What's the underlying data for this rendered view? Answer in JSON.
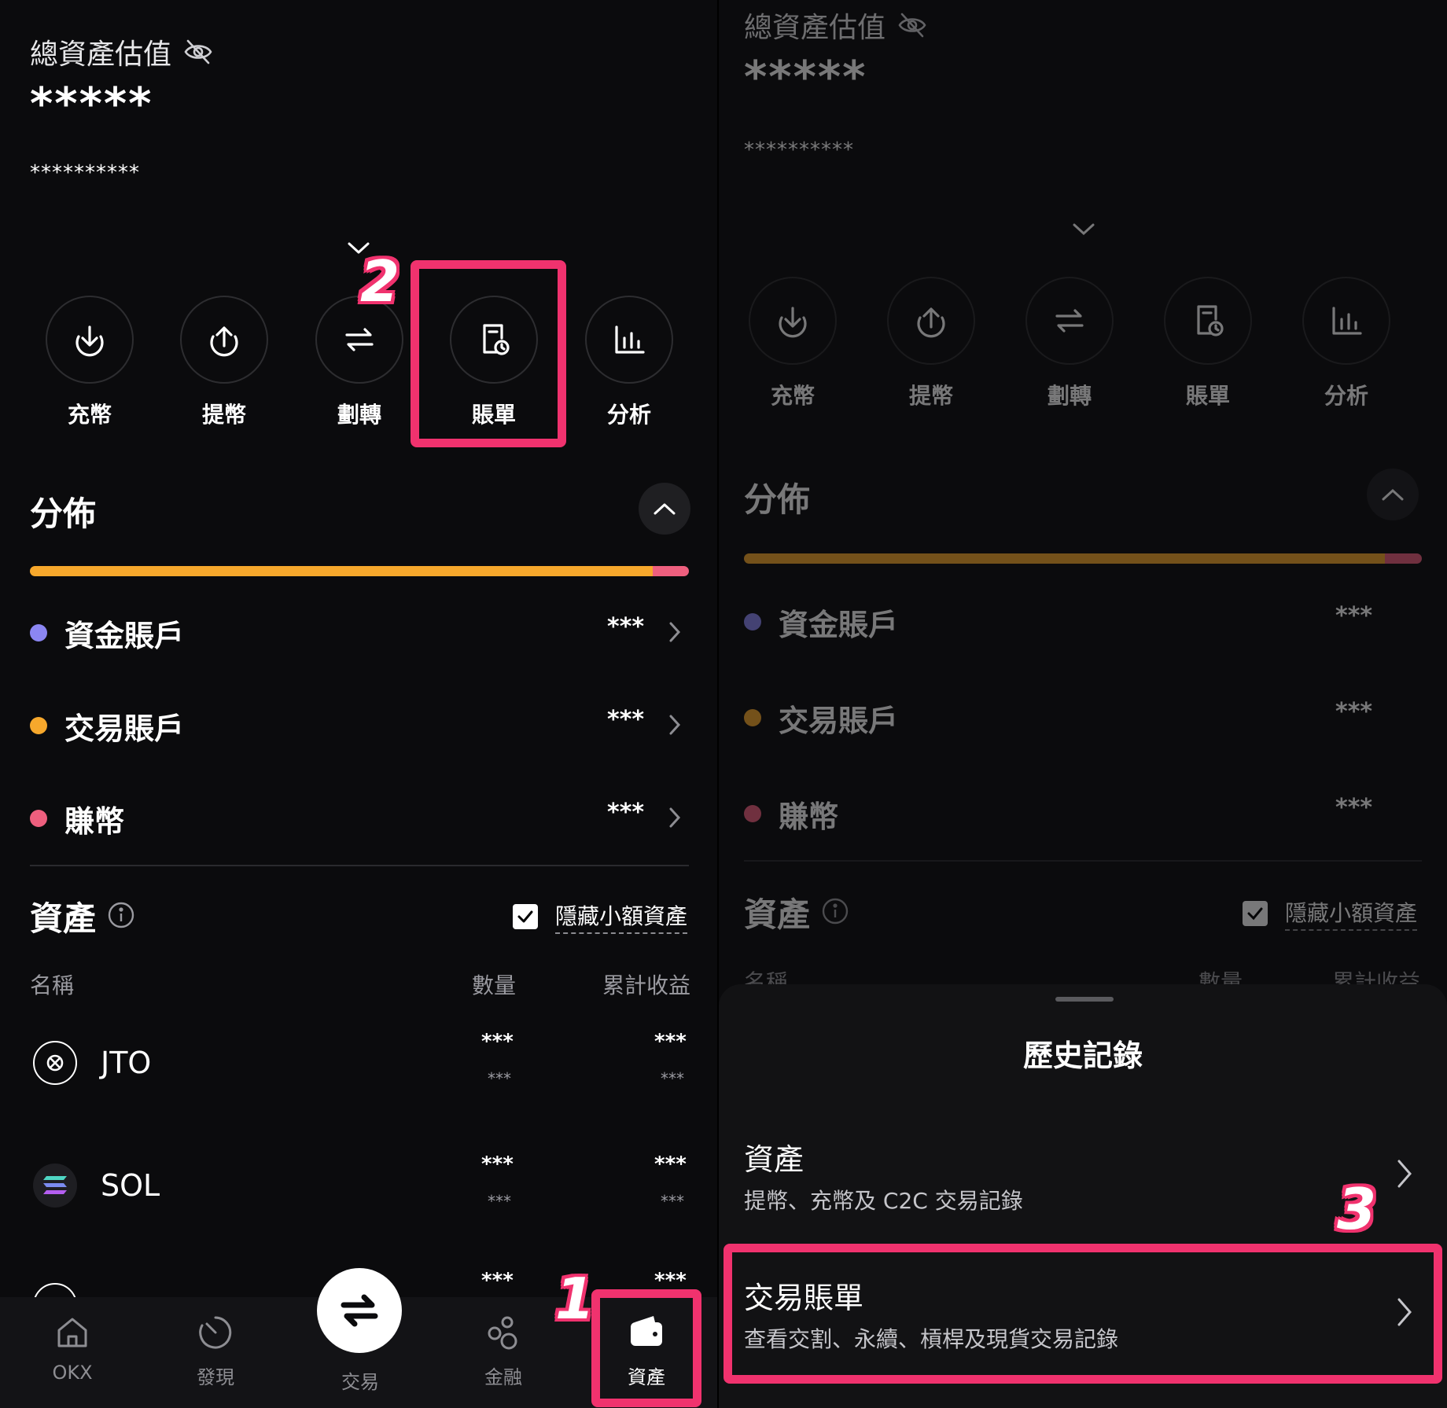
{
  "left": {
    "header": {
      "title": "總資產估值",
      "total_masked": "*****",
      "sub_masked": "**********"
    },
    "actions": [
      {
        "id": "deposit",
        "label": "充幣",
        "icon": "download-icon"
      },
      {
        "id": "withdraw",
        "label": "提幣",
        "icon": "upload-icon"
      },
      {
        "id": "transfer",
        "label": "劃轉",
        "icon": "transfer-arrows-icon"
      },
      {
        "id": "bills",
        "label": "賬單",
        "icon": "bill-clock-icon"
      },
      {
        "id": "analysis",
        "label": "分析",
        "icon": "bar-chart-icon"
      }
    ],
    "distribution": {
      "title": "分佈",
      "bar": {
        "segments": [
          {
            "color": "#f7a82c",
            "fraction": 0.945
          },
          {
            "color": "#ee5f7e",
            "fraction": 0.055
          }
        ]
      },
      "accounts": [
        {
          "name": "資金賬戶",
          "value": "***",
          "color": "#8b86f2"
        },
        {
          "name": "交易賬戶",
          "value": "***",
          "color": "#f7a82c"
        },
        {
          "name": "賺幣",
          "value": "***",
          "color": "#ee5f7e"
        }
      ]
    },
    "assets": {
      "title": "資產",
      "hide_small_label": "隱藏小額資產",
      "hide_small_checked": true,
      "columns": {
        "name": "名稱",
        "qty": "數量",
        "pnl": "累計收益"
      },
      "rows": [
        {
          "symbol": "JTO",
          "qty": "***",
          "qty_sub": "***",
          "pnl": "***",
          "pnl_sub": "***"
        },
        {
          "symbol": "SOL",
          "qty": "***",
          "qty_sub": "***",
          "pnl": "***",
          "pnl_sub": "***"
        },
        {
          "symbol": "",
          "qty": "***",
          "qty_sub": "",
          "pnl": "***",
          "pnl_sub": ""
        }
      ]
    },
    "nav": [
      {
        "label": "OKX",
        "icon": "home-icon"
      },
      {
        "label": "發現",
        "icon": "discover-icon"
      },
      {
        "label": "交易",
        "icon": "trade-swap-icon"
      },
      {
        "label": "金融",
        "icon": "finance-icon"
      },
      {
        "label": "資產",
        "icon": "wallet-icon"
      }
    ],
    "steps": {
      "one": "1",
      "two": "2"
    }
  },
  "right": {
    "header": {
      "title": "總資產估值",
      "total_masked": "*****",
      "sub_masked": "**********"
    },
    "actions": [
      {
        "label": "充幣"
      },
      {
        "label": "提幣"
      },
      {
        "label": "劃轉"
      },
      {
        "label": "賬單"
      },
      {
        "label": "分析"
      }
    ],
    "distribution": {
      "title": "分佈",
      "accounts": [
        {
          "name": "資金賬戶",
          "value": "***"
        },
        {
          "name": "交易賬戶",
          "value": "***"
        },
        {
          "name": "賺幣",
          "value": "***"
        }
      ]
    },
    "assets": {
      "title": "資產",
      "hide_small_label": "隱藏小額資產",
      "columns": {
        "name": "名稱",
        "qty": "數量",
        "pnl": "累計收益"
      }
    },
    "sheet": {
      "title": "歷史記錄",
      "items": [
        {
          "title": "資產",
          "subtitle": "提幣、充幣及 C2C 交易記錄"
        },
        {
          "title": "交易賬單",
          "subtitle": "查看交割、永續、槓桿及現貨交易記錄"
        }
      ]
    },
    "steps": {
      "three": "3"
    }
  },
  "colors": {
    "highlight": "#f0326e",
    "background": "#0b0b0d"
  }
}
